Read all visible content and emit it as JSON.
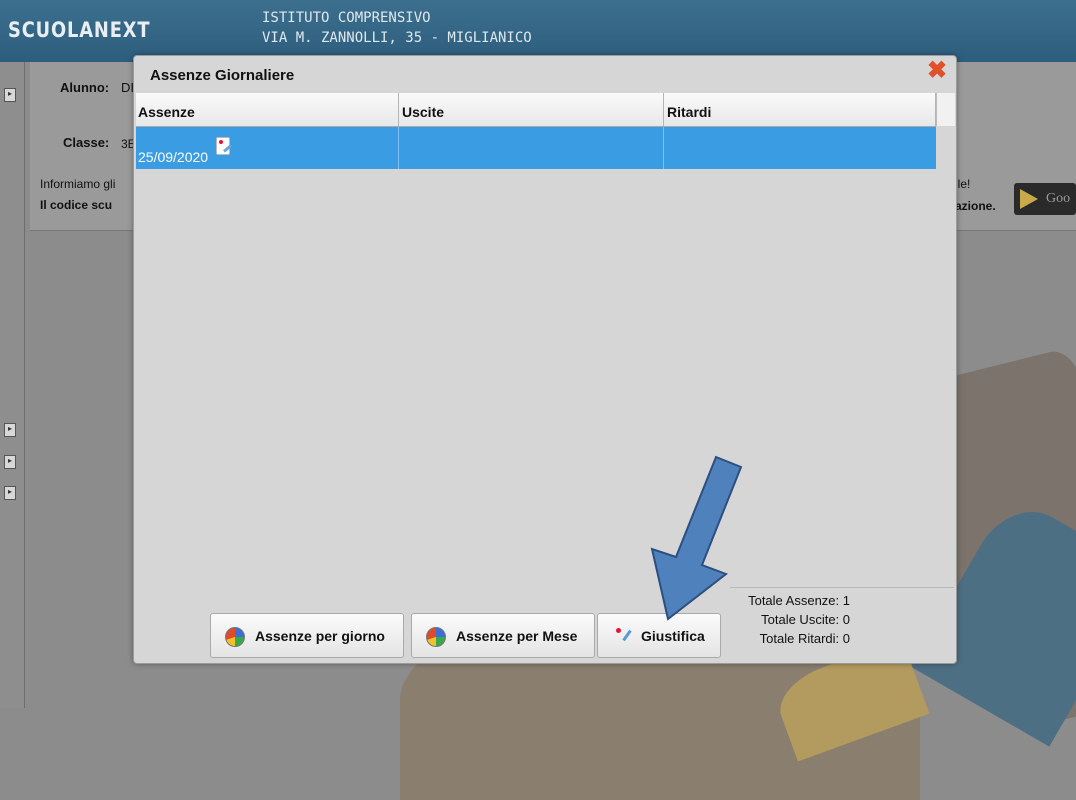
{
  "header": {
    "logo": "SCUOLANEXT",
    "school_line1": "ISTITUTO COMPRENSIVO",
    "school_line2": "VIA M. ZANNOLLI, 35 - MIGLIANICO"
  },
  "info": {
    "alunno_label": "Alunno:",
    "alunno_value": "DI",
    "classe_label": "Classe:",
    "classe_value": "3E",
    "notice_start": "Informiamo gli",
    "notice_end": "ile!",
    "code_start": "Il codice scu",
    "code_end": "azione.",
    "store_text": "Goo"
  },
  "dialog": {
    "title": "Assenze Giornaliere",
    "columns": [
      "Assenze",
      "Uscite",
      "Ritardi"
    ],
    "rows": [
      {
        "assenze": "25/09/2020",
        "uscite": "",
        "ritardi": ""
      }
    ],
    "buttons": {
      "per_giorno": "Assenze per giorno",
      "per_mese": "Assenze per Mese",
      "giustifica": "Giustifica"
    },
    "totals": {
      "assenze": "Totale Assenze: 1",
      "uscite": "Totale Uscite: 0",
      "ritardi": "Totale Ritardi: 0"
    }
  },
  "colors": {
    "selected_row": "#3a9de3",
    "close": "#e0512b",
    "arrow": "#4f81bd"
  },
  "icons": [
    "close-icon",
    "justify-doc-icon",
    "pie-chart-icon",
    "justify-icon",
    "arrow-icon",
    "google-play-icon"
  ]
}
